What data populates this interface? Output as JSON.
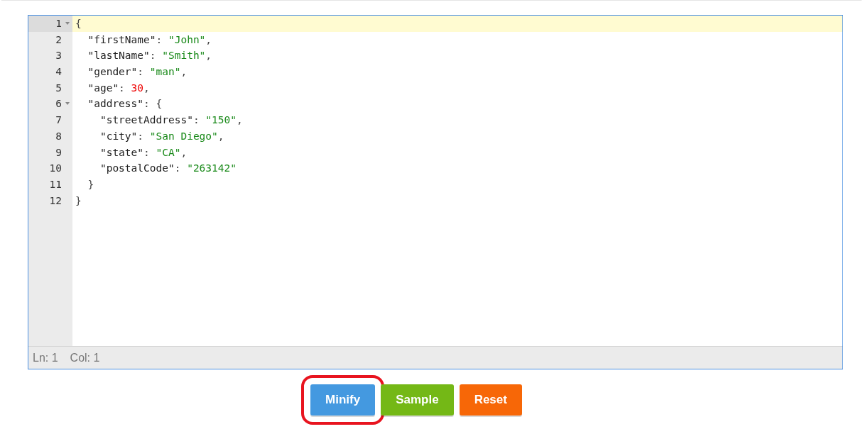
{
  "editor": {
    "lines": [
      {
        "number": "1",
        "foldable": true,
        "active": true,
        "tokens": [
          {
            "kind": "punct",
            "text": "{"
          }
        ]
      },
      {
        "number": "2",
        "foldable": false,
        "active": false,
        "tokens": [
          {
            "kind": "key",
            "text": "  \"firstName\""
          },
          {
            "kind": "punct",
            "text": ": "
          },
          {
            "kind": "string",
            "text": "\"John\""
          },
          {
            "kind": "punct",
            "text": ","
          }
        ]
      },
      {
        "number": "3",
        "foldable": false,
        "active": false,
        "tokens": [
          {
            "kind": "key",
            "text": "  \"lastName\""
          },
          {
            "kind": "punct",
            "text": ": "
          },
          {
            "kind": "string",
            "text": "\"Smith\""
          },
          {
            "kind": "punct",
            "text": ","
          }
        ]
      },
      {
        "number": "4",
        "foldable": false,
        "active": false,
        "tokens": [
          {
            "kind": "key",
            "text": "  \"gender\""
          },
          {
            "kind": "punct",
            "text": ": "
          },
          {
            "kind": "string",
            "text": "\"man\""
          },
          {
            "kind": "punct",
            "text": ","
          }
        ]
      },
      {
        "number": "5",
        "foldable": false,
        "active": false,
        "tokens": [
          {
            "kind": "key",
            "text": "  \"age\""
          },
          {
            "kind": "punct",
            "text": ": "
          },
          {
            "kind": "number",
            "text": "30"
          },
          {
            "kind": "punct",
            "text": ","
          }
        ]
      },
      {
        "number": "6",
        "foldable": true,
        "active": false,
        "tokens": [
          {
            "kind": "key",
            "text": "  \"address\""
          },
          {
            "kind": "punct",
            "text": ": {"
          }
        ]
      },
      {
        "number": "7",
        "foldable": false,
        "active": false,
        "tokens": [
          {
            "kind": "key",
            "text": "    \"streetAddress\""
          },
          {
            "kind": "punct",
            "text": ": "
          },
          {
            "kind": "string",
            "text": "\"150\""
          },
          {
            "kind": "punct",
            "text": ","
          }
        ]
      },
      {
        "number": "8",
        "foldable": false,
        "active": false,
        "tokens": [
          {
            "kind": "key",
            "text": "    \"city\""
          },
          {
            "kind": "punct",
            "text": ": "
          },
          {
            "kind": "string",
            "text": "\"San Diego\""
          },
          {
            "kind": "punct",
            "text": ","
          }
        ]
      },
      {
        "number": "9",
        "foldable": false,
        "active": false,
        "tokens": [
          {
            "kind": "key",
            "text": "    \"state\""
          },
          {
            "kind": "punct",
            "text": ": "
          },
          {
            "kind": "string",
            "text": "\"CA\""
          },
          {
            "kind": "punct",
            "text": ","
          }
        ]
      },
      {
        "number": "10",
        "foldable": false,
        "active": false,
        "tokens": [
          {
            "kind": "key",
            "text": "    \"postalCode\""
          },
          {
            "kind": "punct",
            "text": ": "
          },
          {
            "kind": "string",
            "text": "\"263142\""
          }
        ]
      },
      {
        "number": "11",
        "foldable": false,
        "active": false,
        "tokens": [
          {
            "kind": "punct",
            "text": "  }"
          }
        ]
      },
      {
        "number": "12",
        "foldable": false,
        "active": false,
        "tokens": [
          {
            "kind": "punct",
            "text": "}"
          }
        ]
      }
    ],
    "status_bar": {
      "line": "Ln: 1",
      "column": "Col: 1"
    }
  },
  "buttons": [
    {
      "label": "Minify",
      "kind": "primary",
      "highlighted": true
    },
    {
      "label": "Sample",
      "kind": "success",
      "highlighted": false
    },
    {
      "label": "Reset",
      "kind": "warning",
      "highlighted": false
    }
  ]
}
